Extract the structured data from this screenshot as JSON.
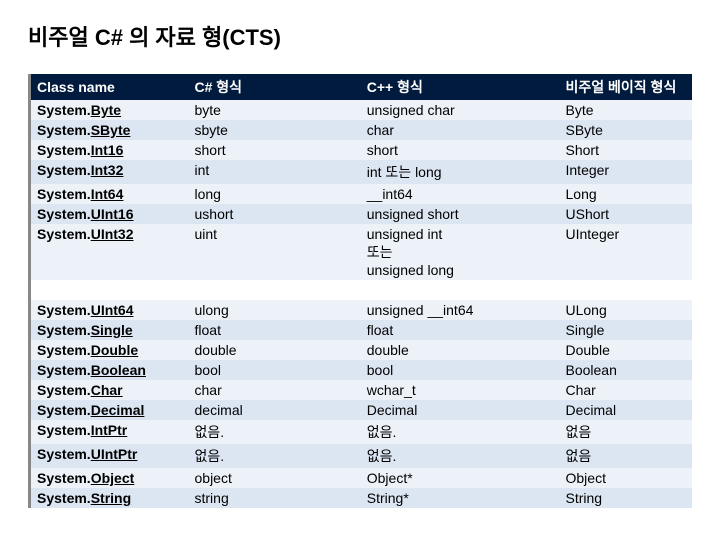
{
  "title": "비주얼 C# 의 자료 형(CTS)",
  "columns": {
    "c1": "Class name",
    "c2": "C# 형식",
    "c3": "C++ 형식",
    "c4": "비주얼 베이직 형식"
  },
  "class_prefix": "System.",
  "rows1": [
    {
      "cls": "Byte",
      "cs": "byte",
      "cpp": "unsigned char",
      "vb": "Byte"
    },
    {
      "cls": "SByte",
      "cs": "sbyte",
      "cpp": "char",
      "vb": "SByte"
    },
    {
      "cls": "Int16",
      "cs": "short",
      "cpp": "short",
      "vb": "Short"
    },
    {
      "cls": "Int32",
      "cs": "int",
      "cpp": "int 또는 long",
      "vb": "Integer"
    },
    {
      "cls": "Int64",
      "cs": "long",
      "cpp": "__int64",
      "vb": "Long"
    },
    {
      "cls": "UInt16",
      "cs": "ushort",
      "cpp": "unsigned short",
      "vb": "UShort"
    },
    {
      "cls": "UInt32",
      "cs": "uint",
      "cpp": "unsigned int\n또는\nunsigned long",
      "vb": "UInteger"
    }
  ],
  "rows2": [
    {
      "cls": "UInt64",
      "cs": "ulong",
      "cpp": "unsigned __int64",
      "vb": "ULong"
    },
    {
      "cls": "Single",
      "cs": "float",
      "cpp": "float",
      "vb": "Single"
    },
    {
      "cls": "Double",
      "cs": "double",
      "cpp": "double",
      "vb": "Double"
    },
    {
      "cls": "Boolean",
      "cs": "bool",
      "cpp": "bool",
      "vb": "Boolean"
    },
    {
      "cls": "Char",
      "cs": "char",
      "cpp": "wchar_t",
      "vb": "Char"
    },
    {
      "cls": "Decimal",
      "cs": "decimal",
      "cpp": "Decimal",
      "vb": "Decimal"
    },
    {
      "cls": "IntPtr",
      "cs": "없음.",
      "cpp": "없음.",
      "vb": "없음"
    },
    {
      "cls": "UIntPtr",
      "cs": "없음.",
      "cpp": "없음.",
      "vb": "없음"
    },
    {
      "cls": "Object",
      "cs": "object",
      "cpp": "Object*",
      "vb": "Object"
    },
    {
      "cls": "String",
      "cs": "string",
      "cpp": "String*",
      "vb": "String"
    }
  ]
}
